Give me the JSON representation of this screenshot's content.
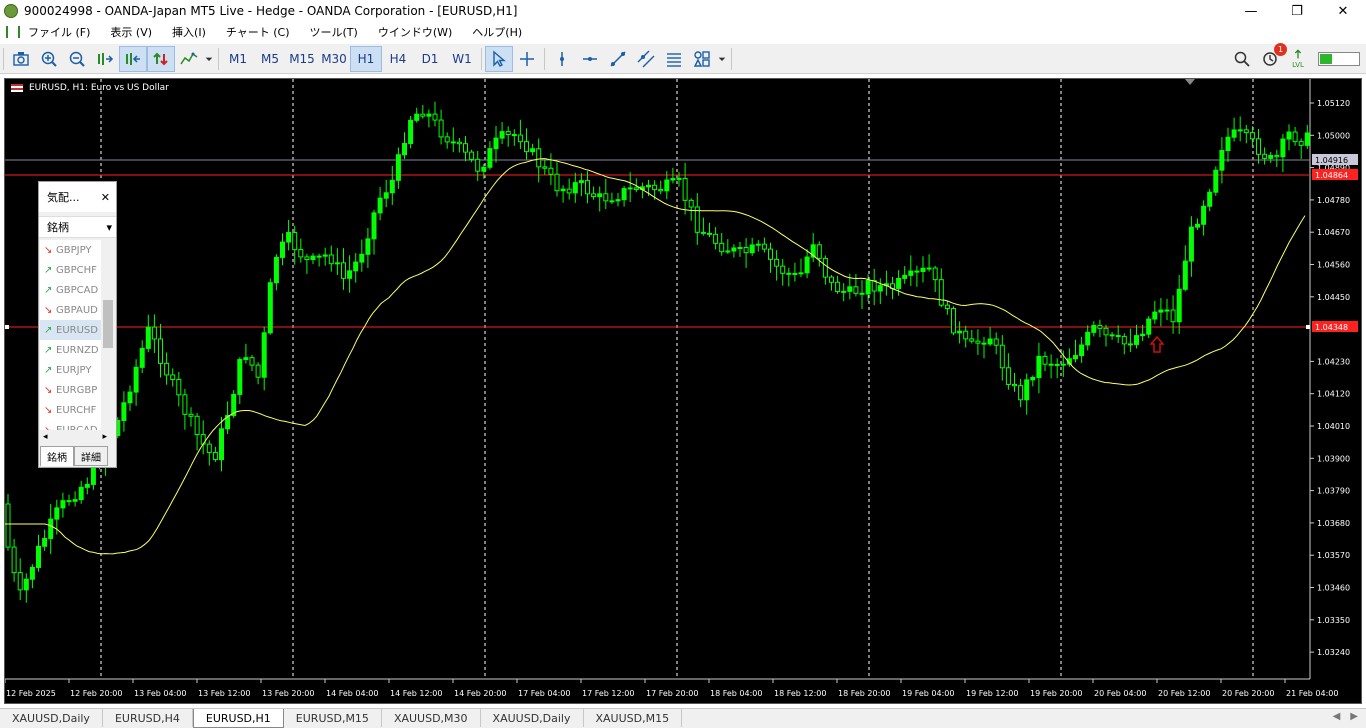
{
  "window": {
    "title": "900024998 - OANDA-Japan MT5 Live - Hedge - OANDA Corporation - [EURUSD,H1]",
    "minimize": "—",
    "maximize": "❐",
    "close": "✕"
  },
  "menu": [
    "ファイル (F)",
    "表示 (V)",
    "挿入(I)",
    "チャート (C)",
    "ツール(T)",
    "ウインドウ(W)",
    "ヘルプ(H)"
  ],
  "toolbar": {
    "timeframes": [
      "M1",
      "M5",
      "M15",
      "M30",
      "H1",
      "H4",
      "D1",
      "W1"
    ],
    "active_timeframe": "H1",
    "notification_count": "1",
    "lvl_label": "LVL"
  },
  "chart": {
    "title": "EURUSD, H1:  Euro vs US Dollar",
    "price_labels": [
      "1.05120",
      "1.05000",
      "1.04890",
      "1.04780",
      "1.04670",
      "1.04560",
      "1.04450",
      "1.04230",
      "1.04120",
      "1.04010",
      "1.03900",
      "1.03790",
      "1.03680",
      "1.03570",
      "1.03460",
      "1.03350",
      "1.03240"
    ],
    "bid_label": "1.04916",
    "hline_upper_label": "1.04864",
    "hline_lower_label": "1.04348",
    "time_labels": [
      "12 Feb 2025",
      "12 Feb 20:00",
      "13 Feb 04:00",
      "13 Feb 12:00",
      "13 Feb 20:00",
      "14 Feb 04:00",
      "14 Feb 12:00",
      "14 Feb 20:00",
      "17 Feb 04:00",
      "17 Feb 12:00",
      "17 Feb 20:00",
      "18 Feb 04:00",
      "18 Feb 12:00",
      "18 Feb 20:00",
      "19 Feb 04:00",
      "19 Feb 12:00",
      "19 Feb 20:00",
      "20 Feb 04:00",
      "20 Feb 12:00",
      "20 Feb 20:00",
      "21 Feb 04:00"
    ],
    "colors": {
      "background": "#000000",
      "candle": "#00ff00",
      "moving_average": "#ffff66",
      "hline": "#ff2020",
      "bid_line": "#8888a0",
      "arrow": "#cc1010"
    }
  },
  "market_watch": {
    "title": "気配...",
    "close": "✕",
    "column": "銘柄",
    "rows": [
      {
        "symbol": "GBPJPY",
        "dir": "down"
      },
      {
        "symbol": "GBPCHF",
        "dir": "up"
      },
      {
        "symbol": "GBPCAD",
        "dir": "up"
      },
      {
        "symbol": "GBPAUD",
        "dir": "down"
      },
      {
        "symbol": "EURUSD",
        "dir": "up"
      },
      {
        "symbol": "EURNZD",
        "dir": "up"
      },
      {
        "symbol": "EURJPY",
        "dir": "up"
      },
      {
        "symbol": "EURGBP",
        "dir": "down"
      },
      {
        "symbol": "EURCHF",
        "dir": "down"
      },
      {
        "symbol": "EURCAD",
        "dir": "down"
      }
    ],
    "tabs": [
      "銘柄",
      "詳細"
    ],
    "active_tab": "銘柄"
  },
  "tabs": [
    "XAUUSD,Daily",
    "EURUSD,H4",
    "EURUSD,H1",
    "EURUSD,M15",
    "XAUUSD,M30",
    "XAUUSD,Daily",
    "XAUUSD,M15"
  ],
  "active_tab": "EURUSD,H1"
}
